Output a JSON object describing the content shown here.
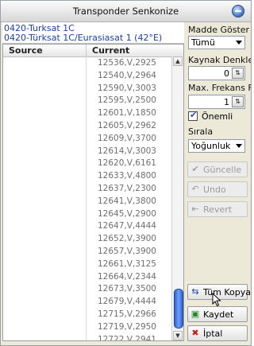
{
  "window": {
    "title": "Transponder Senkonize"
  },
  "info": {
    "line1": "0420-Turksat 1C",
    "line2": "0420-Türksat 1C/Eurasiasat 1 (42°E)"
  },
  "grid": {
    "columns": [
      "Source",
      "Current"
    ],
    "rows": [
      "12536,V,2925",
      "12540,V,2964",
      "12590,V,3003",
      "12595,V,2500",
      "12601,V,1850",
      "12605,V,2962",
      "12609,V,3700",
      "12614,V,3003",
      "12620,V,6161",
      "12633,V,4800",
      "12637,V,2300",
      "12641,V,3800",
      "12645,V,2900",
      "12647,V,4444",
      "12652,V,3900",
      "12657,V,3900",
      "12661,V,3125",
      "12664,V,2344",
      "12673,V,3500",
      "12679,V,4444",
      "12715,V,2966",
      "12719,V,2950",
      "12722,V,2941",
      "12727,V,2941"
    ]
  },
  "side": {
    "madde_label": "Madde Göster",
    "madde_value": "Tümü",
    "kaynak_label": "Kaynak Denklesi",
    "kaynak_value": "0",
    "maxfrek_label": "Max. Frekans Fa",
    "maxfrek_value": "1",
    "onemli_label": "Önemli",
    "onemli_checked": true,
    "sirala_label": "Sırala",
    "sirala_value": "Yoğunluk",
    "buttons": {
      "guncelle": "Güncelle",
      "undo": "Undo",
      "revert": "Revert",
      "tum_kopyala": "Tüm Kopyala",
      "kaydet": "Kaydet",
      "iptal": "İptal"
    }
  },
  "icons": {
    "window_button": "minimize-icon",
    "spin": "spin-arrows-icon",
    "guncelle": "check-icon",
    "undo": "undo-icon",
    "revert": "revert-icon",
    "tum_kopyala": "copy-arrows-icon",
    "kaydet": "save-icon",
    "iptal": "cancel-icon"
  },
  "colors": {
    "accent_blue": "#1a3fa8",
    "iptal_red": "#c0201a",
    "kaydet_green": "#1f8a2a"
  }
}
